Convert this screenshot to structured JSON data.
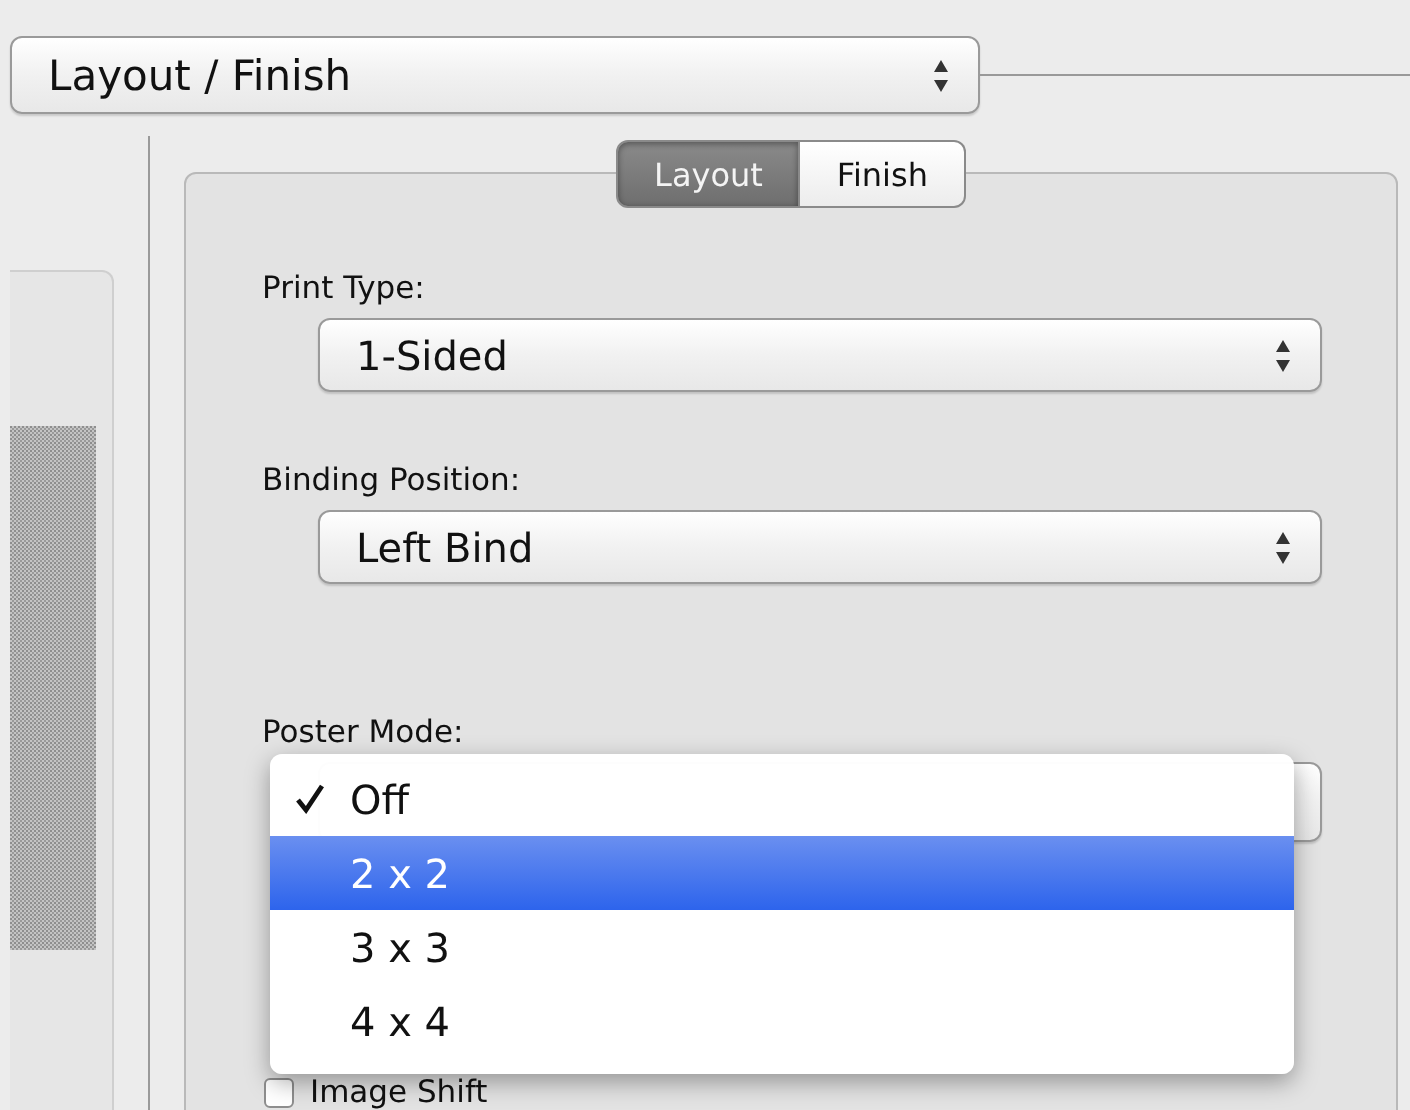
{
  "print_menu": {
    "value": "Layout / Finish"
  },
  "tabs": [
    {
      "label": "Layout",
      "selected": true
    },
    {
      "label": "Finish",
      "selected": false
    }
  ],
  "fields": [
    {
      "label": "Print Type:",
      "value": "1-Sided"
    },
    {
      "label": "Binding Position:",
      "value": "Left Bind"
    }
  ],
  "poster_mode": {
    "label": "Poster Mode:",
    "options": [
      {
        "label": "Off",
        "checked": true,
        "selected": false
      },
      {
        "label": "2 x 2",
        "checked": false,
        "selected": true
      },
      {
        "label": "3 x 3",
        "checked": false,
        "selected": false
      },
      {
        "label": "4 x 4",
        "checked": false,
        "selected": false
      }
    ]
  },
  "checkboxes": [
    {
      "label": "Image Shift",
      "checked": false
    }
  ]
}
